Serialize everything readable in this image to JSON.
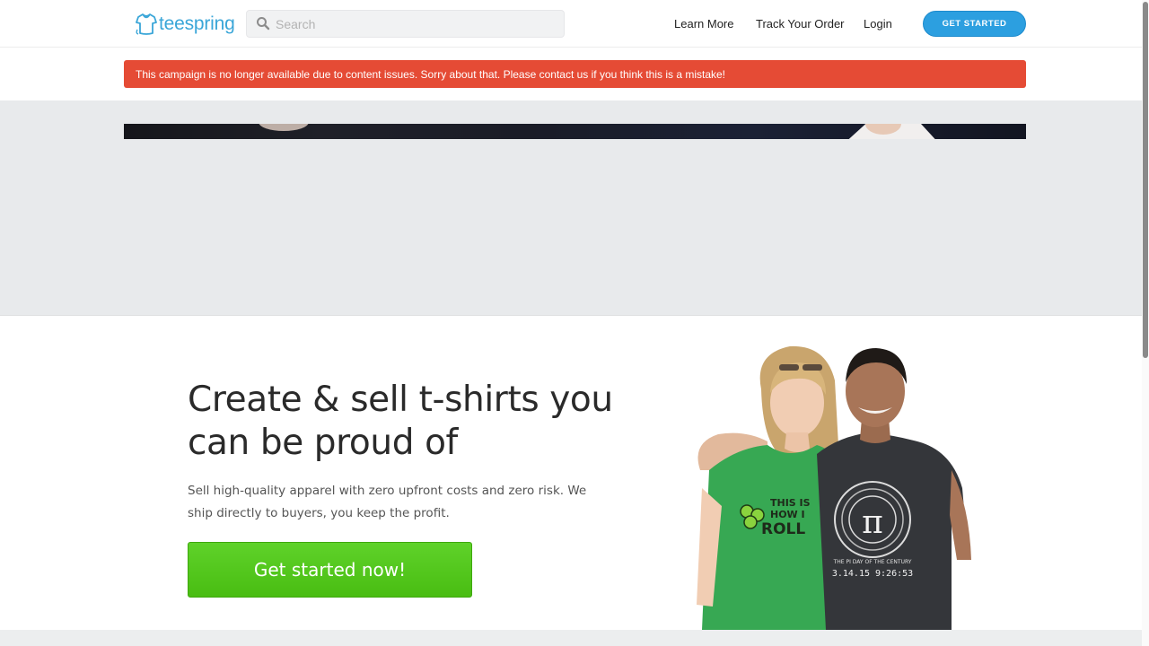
{
  "header": {
    "logo_text": "teespring",
    "search_placeholder": "Search",
    "nav": {
      "learn_more": "Learn More",
      "track_order": "Track Your Order",
      "login": "Login"
    },
    "cta_label": "GET STARTED"
  },
  "alert": {
    "message": "This campaign is no longer available due to content issues. Sorry about that. Please contact us if you think this is a mistake!"
  },
  "hero": {
    "title": "Create & sell t-shirts you can be proud of",
    "subtitle": "Sell high-quality apparel with zero upfront costs and zero risk. We ship directly to buyers, you keep the profit.",
    "cta_label": "Get started now!",
    "shirt_green_text": [
      "THIS IS",
      "HOW I",
      "ROLL"
    ],
    "shirt_black_text": [
      "π",
      "THE PI DAY OF THE CENTURY",
      "3.14.15 9:26:53"
    ]
  },
  "colors": {
    "brand": "#3aa6d8",
    "cta_blue": "#2c9fe0",
    "alert_red": "#e54b35",
    "cta_green": "#4fc51a",
    "grey_area": "#e8eaec"
  }
}
